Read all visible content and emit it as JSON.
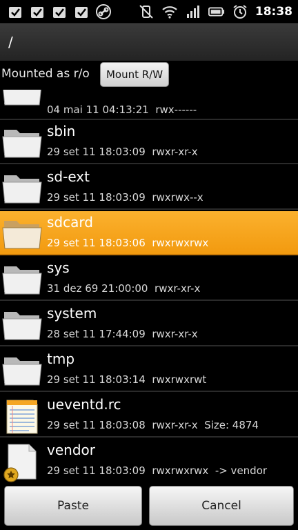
{
  "status_bar": {
    "time": "18:38",
    "left_icons": [
      "checkbox-notification-icon",
      "checkbox-notification-icon",
      "checkbox-notification-icon",
      "checkbox-notification-icon",
      "link-icon"
    ],
    "right_icons": [
      "vibrate-mute-icon",
      "wifi-icon",
      "signal-icon",
      "battery-icon",
      "alarm-icon"
    ]
  },
  "path": "/",
  "mount": {
    "label": "Mounted as r/o",
    "button": "Mount R/W"
  },
  "items": [
    {
      "name": "",
      "date": "04 mai 11 04:13:21",
      "perms": "rwx------",
      "extra": "",
      "icon": "folder-icon",
      "selected": false
    },
    {
      "name": "sbin",
      "date": "29 set 11 18:03:09",
      "perms": "rwxr-xr-x",
      "extra": "",
      "icon": "folder-icon",
      "selected": false
    },
    {
      "name": "sd-ext",
      "date": "29 set 11 18:03:09",
      "perms": "rwxrwx--x",
      "extra": "",
      "icon": "folder-icon",
      "selected": false
    },
    {
      "name": "sdcard",
      "date": "29 set 11 18:03:06",
      "perms": "rwxrwxrwx",
      "extra": "",
      "icon": "folder-icon",
      "selected": true
    },
    {
      "name": "sys",
      "date": "31 dez 69 21:00:00",
      "perms": "rwxr-xr-x",
      "extra": "",
      "icon": "folder-icon",
      "selected": false
    },
    {
      "name": "system",
      "date": "28 set 11 17:44:09",
      "perms": "rwxr-xr-x",
      "extra": "",
      "icon": "folder-icon",
      "selected": false
    },
    {
      "name": "tmp",
      "date": "29 set 11 18:03:14",
      "perms": "rwxrwxrwt",
      "extra": "",
      "icon": "folder-icon",
      "selected": false
    },
    {
      "name": "ueventd.rc",
      "date": "29 set 11 18:03:08",
      "perms": "rwxr-xr-x",
      "extra": "Size: 4874",
      "icon": "text-file-icon",
      "selected": false
    },
    {
      "name": "vendor",
      "date": "29 set 11 18:03:09",
      "perms": "rwxrwxrwx",
      "extra": "-> vendor",
      "icon": "symlink-file-icon",
      "selected": false
    }
  ],
  "buttons": {
    "paste": "Paste",
    "cancel": "Cancel"
  }
}
